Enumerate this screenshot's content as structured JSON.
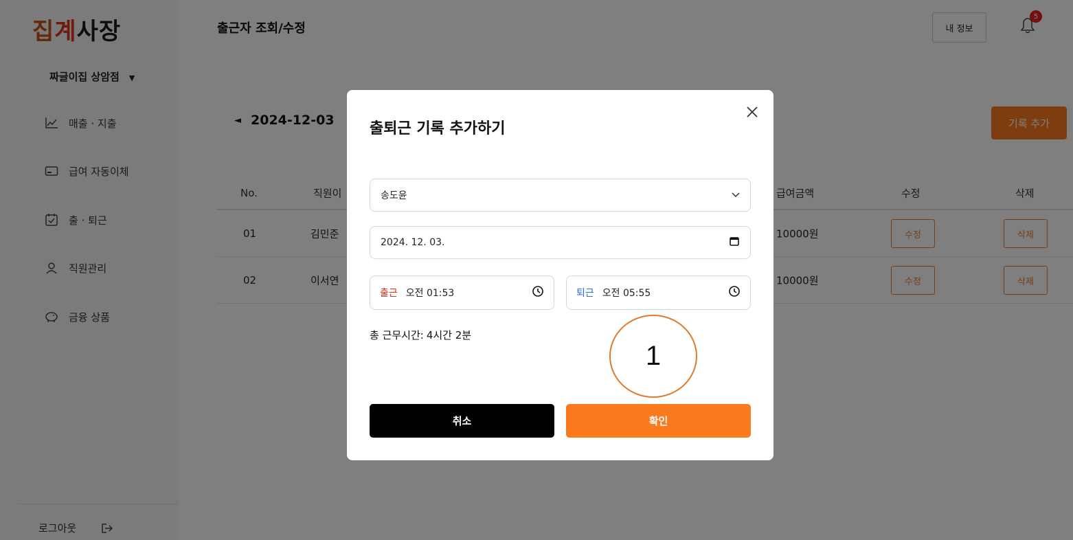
{
  "sidebar": {
    "logo": {
      "part1": "집",
      "part2": "계",
      "part3": "사장"
    },
    "store_name": "짜글이집 상암점",
    "store_caret": "▼",
    "items": [
      {
        "label": "매출 · 지출",
        "icon": "chart-line-icon"
      },
      {
        "label": "급여 자동이체",
        "icon": "card-icon"
      },
      {
        "label": "출 · 퇴근",
        "icon": "calendar-check-icon"
      },
      {
        "label": "직원관리",
        "icon": "person-icon"
      },
      {
        "label": "금융 상품",
        "icon": "piggy-bank-icon"
      }
    ],
    "logout_label": "로그아웃",
    "logout_icon": "logout-icon"
  },
  "header": {
    "title": "출근자 조회/수정",
    "my_info_label": "내 정보",
    "notification_count": "5"
  },
  "main": {
    "date_arrow": "◄",
    "date": "2024-12-03",
    "add_record_label": "기록 추가",
    "table": {
      "columns": [
        "No.",
        "직원이",
        "급여금액",
        "수정",
        "삭제"
      ],
      "rows": [
        {
          "no": "01",
          "name": "김민준",
          "pay": "10000원",
          "edit": "수정",
          "delete": "삭제"
        },
        {
          "no": "02",
          "name": "이서연",
          "pay": "10000원",
          "edit": "수정",
          "delete": "삭제"
        }
      ]
    }
  },
  "modal": {
    "title": "출퇴근 기록 추가하기",
    "employee_value": "송도윤",
    "date_value": "2024. 12. 03.",
    "clock_in_label": "출근",
    "clock_in_value": "오전 01:53",
    "clock_out_label": "퇴근",
    "clock_out_value": "오전 05:55",
    "total_label": "총 근무시간:",
    "total_value": "4시간 2분",
    "cancel_label": "취소",
    "confirm_label": "확인"
  },
  "annotation_marker": "1",
  "colors": {
    "accent": "#fb7a1e",
    "clock_in": "#e0321c",
    "clock_out": "#2f6fd6",
    "badge": "#e5231f"
  }
}
